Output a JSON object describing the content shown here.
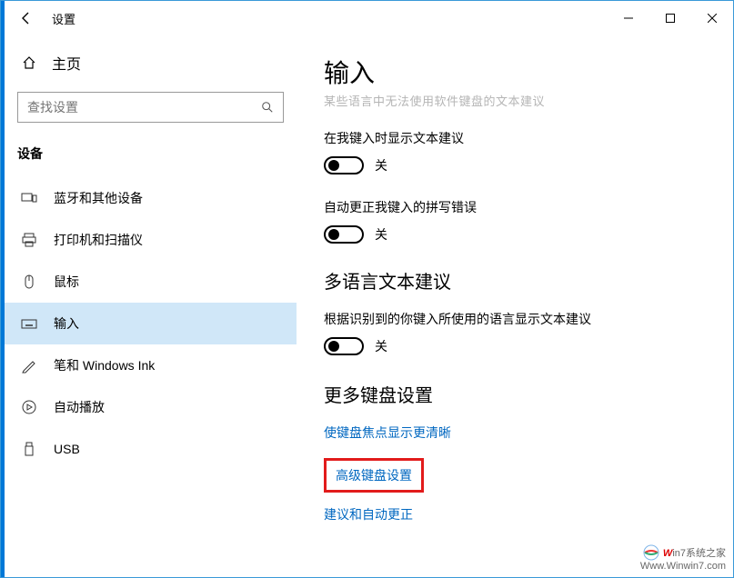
{
  "titlebar": {
    "title": "设置"
  },
  "sidebar": {
    "home_label": "主页",
    "search_placeholder": "查找设置",
    "section_label": "设备",
    "items": [
      {
        "label": "蓝牙和其他设备"
      },
      {
        "label": "打印机和扫描仪"
      },
      {
        "label": "鼠标"
      },
      {
        "label": "输入"
      },
      {
        "label": "笔和 Windows Ink"
      },
      {
        "label": "自动播放"
      },
      {
        "label": "USB"
      }
    ]
  },
  "content": {
    "heading": "输入",
    "faint_desc": "某些语言中无法使用软件键盘的文本建议",
    "toggle1_label": "在我键入时显示文本建议",
    "toggle1_state": "关",
    "toggle2_label": "自动更正我键入的拼写错误",
    "toggle2_state": "关",
    "section_multilang": "多语言文本建议",
    "multilang_desc": "根据识别到的你键入所使用的语言显示文本建议",
    "toggle3_state": "关",
    "section_more": "更多键盘设置",
    "link_focus": "使键盘焦点显示更清晰",
    "link_advanced": "高级键盘设置",
    "link_suggest": "建议和自动更正"
  },
  "watermark": {
    "brand_prefix": "W",
    "brand_text": "in7系统之家",
    "url": "Www.Winwin7.com"
  }
}
